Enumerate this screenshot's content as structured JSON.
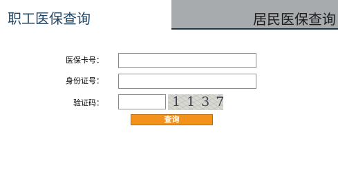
{
  "tabs": {
    "employee": {
      "label": "职工医保查询"
    },
    "resident": {
      "label": "居民医保查询"
    }
  },
  "form": {
    "card_number": {
      "label": "医保卡号：",
      "value": ""
    },
    "id_number": {
      "label": "身份证号：",
      "value": ""
    },
    "verification": {
      "label": "验证码：",
      "value": "",
      "captcha_text": "1137"
    }
  },
  "submit": {
    "label": "查询"
  },
  "colors": {
    "tab_active_text": "#1f4566",
    "tab_inactive_bg": "#a8abae",
    "tab_underline": "#1f3347",
    "button_bg": "#f3921a"
  }
}
